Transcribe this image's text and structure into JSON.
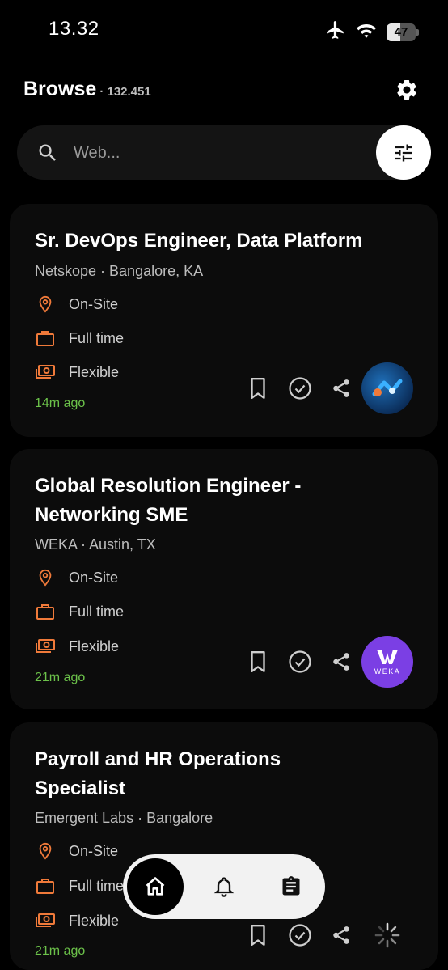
{
  "status_bar": {
    "time": "13.32",
    "battery": "47",
    "battery_level": 0.47
  },
  "header": {
    "title": "Browse",
    "count": "· 132.451"
  },
  "search": {
    "placeholder": "Web..."
  },
  "colors": {
    "accent": "#f07a3a",
    "posted": "#6cc24a",
    "card_bg": "#0c0c0c"
  },
  "jobs": [
    {
      "title": "Sr. DevOps Engineer, Data Platform",
      "company_location": "Netskope · Bangalore, KA",
      "work_mode": "On-Site",
      "employment_type": "Full time",
      "salary": "Flexible",
      "posted": "14m ago",
      "logo_icon": "netskope-logo"
    },
    {
      "title": "Global Resolution Engineer - Networking SME",
      "company_location": "WEKA · Austin, TX",
      "work_mode": "On-Site",
      "employment_type": "Full time",
      "salary": "Flexible",
      "posted": "21m ago",
      "logo_text": "WEKA",
      "logo_icon": "weka-logo"
    },
    {
      "title": "Payroll and HR Operations Specialist",
      "company_location": "Emergent Labs · Bangalore",
      "work_mode": "On-Site",
      "employment_type": "Full time",
      "salary": "Flexible",
      "posted": "21m ago",
      "logo_icon": "loading-spinner-icon"
    }
  ],
  "nav": {
    "items": [
      "home-icon",
      "bell-icon",
      "clipboard-icon"
    ],
    "active": "home-icon"
  }
}
